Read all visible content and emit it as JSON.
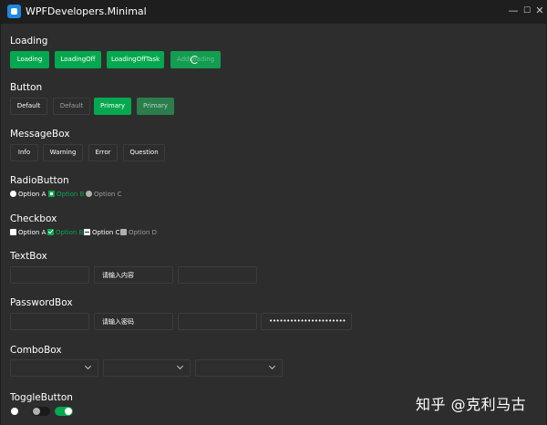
{
  "window": {
    "title": "WPFDevelopers.Minimal",
    "controls": {
      "minimize": "—",
      "maximize": "☐",
      "close": "✕"
    }
  },
  "loading": {
    "title": "Loading",
    "buttons": [
      "Loading",
      "LoadingOff",
      "LoadingOffTask",
      "AddLoading"
    ]
  },
  "button": {
    "title": "Button",
    "buttons": [
      "Default",
      "Default",
      "Primary",
      "Primary"
    ]
  },
  "messagebox": {
    "title": "MessageBox",
    "buttons": [
      "Info",
      "Warning",
      "Error",
      "Question"
    ]
  },
  "radiobutton": {
    "title": "RadioButton",
    "options": [
      "Option A",
      "Option B",
      "Option C"
    ],
    "selected": "Option B"
  },
  "checkbox": {
    "title": "Checkbox",
    "options": [
      "Option A",
      "Option B",
      "Option C",
      "Option D"
    ]
  },
  "textbox": {
    "title": "TextBox",
    "placeholder": "请输入内容"
  },
  "passwordbox": {
    "title": "PasswordBox",
    "placeholder": "请输入密码",
    "masked_value": "••••••••••••••••••••••"
  },
  "combobox": {
    "title": "ComboBox"
  },
  "togglebutton": {
    "title": "ToggleButton"
  },
  "colors": {
    "accent": "#06a84f",
    "background": "#2d2d2d",
    "titlebar": "#1e1e1e",
    "border": "#3c3c3c"
  },
  "watermark": "知乎 @克利马古"
}
